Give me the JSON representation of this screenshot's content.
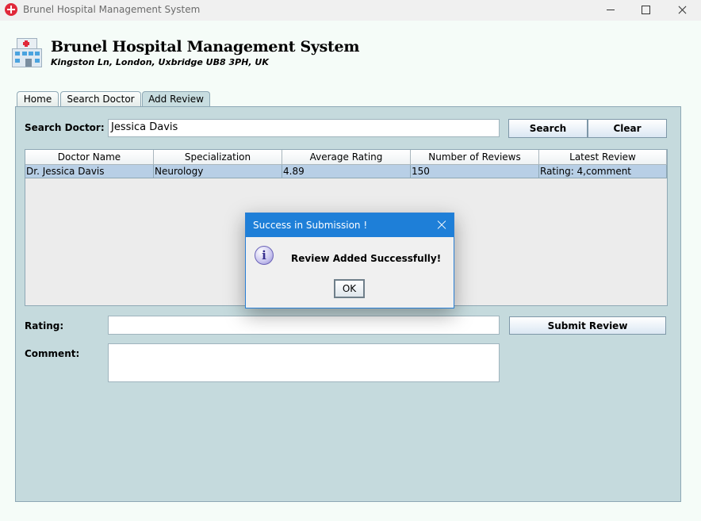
{
  "window": {
    "title": "Brunel Hospital Management System"
  },
  "header": {
    "title": "Brunel Hospital Management System",
    "address": "Kingston Ln, London, Uxbridge UB8 3PH, UK"
  },
  "tabs": [
    {
      "label": "Home"
    },
    {
      "label": "Search Doctor"
    },
    {
      "label": "Add Review",
      "selected": true
    }
  ],
  "search": {
    "label": "Search Doctor:",
    "value": "Jessica Davis",
    "search_button": "Search",
    "clear_button": "Clear"
  },
  "table": {
    "columns": [
      "Doctor Name",
      "Specialization",
      "Average Rating",
      "Number of Reviews",
      "Latest Review"
    ],
    "rows": [
      [
        "Dr. Jessica Davis",
        "Neurology",
        "4.89",
        "150",
        "Rating: 4,comment"
      ]
    ]
  },
  "review_form": {
    "rating_label": "Rating:",
    "rating_value": "",
    "comment_label": "Comment:",
    "comment_value": "",
    "submit_button": "Submit Review"
  },
  "dialog": {
    "title": "Success in Submission !",
    "message": "Review Added Successfully!",
    "ok_button": "OK"
  },
  "colors": {
    "dialog_titlebar": "#1e7fd8",
    "panel_background": "#c5dadd",
    "selected_row": "#b8cfe6"
  }
}
